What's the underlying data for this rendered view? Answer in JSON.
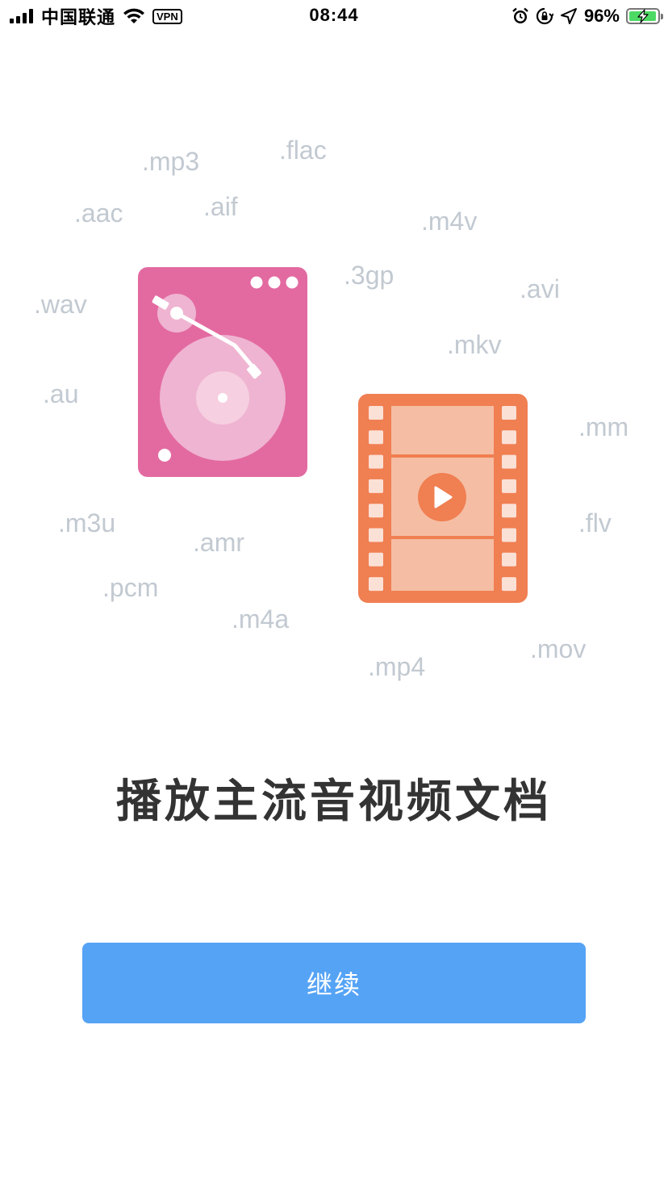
{
  "status_bar": {
    "carrier": "中国联通",
    "vpn": "VPN",
    "time": "08:44",
    "battery_percent": "96%",
    "battery_level": 0.96,
    "icons": [
      "signal-icon",
      "wifi-icon",
      "alarm-icon",
      "rotation-lock-icon",
      "location-arrow-icon",
      "battery-charging-icon"
    ]
  },
  "formats": [
    ".mp3",
    ".flac",
    ".aac",
    ".aif",
    ".m4v",
    ".3gp",
    ".avi",
    ".wav",
    ".mkv",
    ".au",
    ".mm",
    ".m3u",
    ".amr",
    ".flv",
    ".pcm",
    ".m4a",
    ".mov",
    ".mp4"
  ],
  "illustrations": {
    "turntable": "turntable-icon",
    "film": "film-strip-play-icon",
    "colors": {
      "turntable_bg": "#e36aa1",
      "turntable_disc": "#efb4d1",
      "film_bg": "#f07f52",
      "film_frame": "#f5bea4",
      "film_hole": "#fbe0d5"
    }
  },
  "headline": "播放主流音视频文档",
  "continue_button": {
    "label": "继续",
    "color": "#55a3f5"
  }
}
